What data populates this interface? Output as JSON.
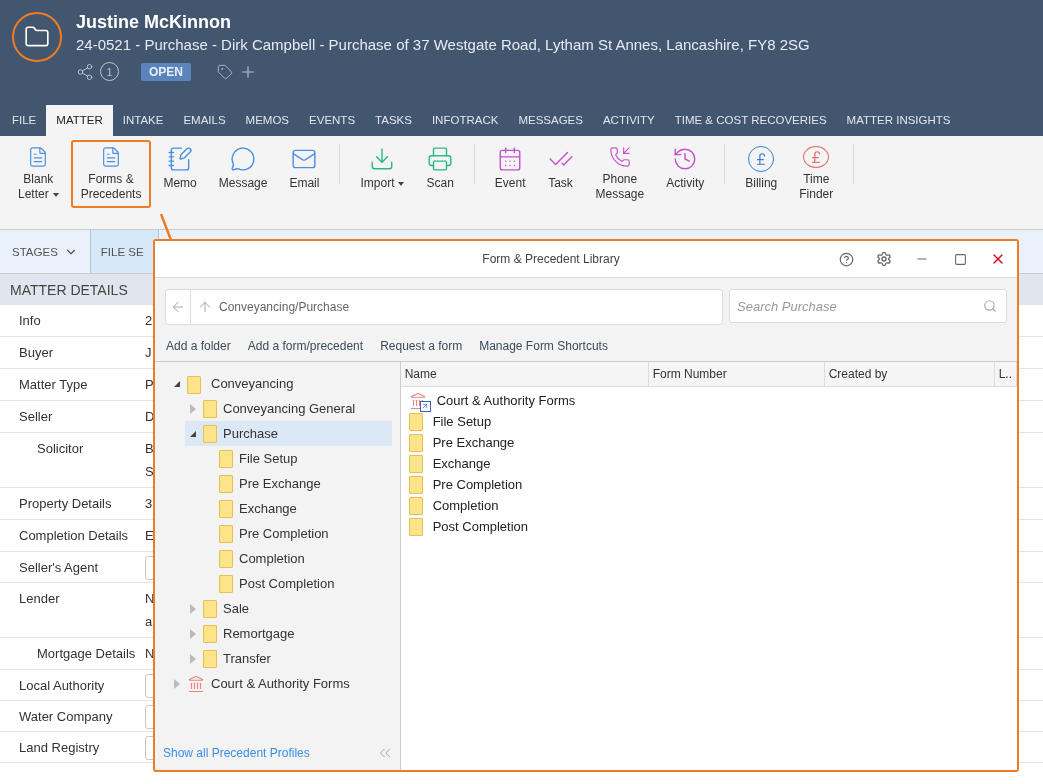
{
  "matter": {
    "client": "Justine McKinnon",
    "description": "24-0521 - Purchase - Dirk Campbell - Purchase of 37 Westgate Road, Lytham St Annes, Lancashire, FY8 2SG",
    "related_count": "1",
    "status": "OPEN"
  },
  "tabs": [
    {
      "label": "FILE",
      "selected": false
    },
    {
      "label": "MATTER",
      "selected": true
    },
    {
      "label": "INTAKE",
      "selected": false
    },
    {
      "label": "EMAILS",
      "selected": false
    },
    {
      "label": "MEMOS",
      "selected": false
    },
    {
      "label": "EVENTS",
      "selected": false
    },
    {
      "label": "TASKS",
      "selected": false
    },
    {
      "label": "INFOTRACK",
      "selected": false
    },
    {
      "label": "MESSAGES",
      "selected": false
    },
    {
      "label": "ACTIVITY",
      "selected": false
    },
    {
      "label": "TIME & COST RECOVERIES",
      "selected": false
    },
    {
      "label": "MATTER INSIGHTS",
      "selected": false
    }
  ],
  "ribbon_groups": [
    [
      {
        "label": "Blank\nLetter",
        "dropdown": true,
        "highlighted": false
      },
      {
        "label": "Forms &\nPrecedents",
        "dropdown": false,
        "highlighted": true
      },
      {
        "label": "Memo",
        "dropdown": false,
        "highlighted": false
      },
      {
        "label": "Message",
        "dropdown": false,
        "highlighted": false
      },
      {
        "label": "Email",
        "dropdown": false,
        "highlighted": false
      }
    ],
    [
      {
        "label": "Import",
        "dropdown": true,
        "highlighted": false
      },
      {
        "label": "Scan",
        "dropdown": false,
        "highlighted": false
      }
    ],
    [
      {
        "label": "Event",
        "dropdown": false,
        "highlighted": false
      },
      {
        "label": "Task",
        "dropdown": false,
        "highlighted": false
      },
      {
        "label": "Phone\nMessage",
        "dropdown": false,
        "highlighted": false
      },
      {
        "label": "Activity",
        "dropdown": false,
        "highlighted": false
      }
    ],
    [
      {
        "label": "Billing",
        "dropdown": false,
        "highlighted": false
      },
      {
        "label": "Time\nFinder",
        "dropdown": false,
        "highlighted": false
      }
    ]
  ],
  "stages": {
    "label": "STAGES",
    "current": "FILE SE"
  },
  "matter_details": {
    "title": "MATTER DETAILS",
    "rows": [
      {
        "label": "Info",
        "kind": "text",
        "lines": [
          "2"
        ]
      },
      {
        "label": "Buyer",
        "kind": "text",
        "lines": [
          "J"
        ]
      },
      {
        "label": "Matter Type",
        "kind": "text",
        "lines": [
          "P"
        ]
      },
      {
        "label": "Seller",
        "kind": "text",
        "lines": [
          "D"
        ]
      },
      {
        "label": "Solicitor",
        "kind": "sub",
        "lines": [
          "B",
          "S"
        ]
      },
      {
        "label": "Property Details",
        "kind": "text",
        "lines": [
          "3"
        ]
      },
      {
        "label": "Completion Details",
        "kind": "text",
        "lines": [
          "E"
        ]
      },
      {
        "label": "Seller's Agent",
        "kind": "lookup",
        "lines": []
      },
      {
        "label": "Lender",
        "kind": "text",
        "lines": [
          "N",
          "a"
        ]
      },
      {
        "label": "Mortgage Details",
        "kind": "sub",
        "lines": [
          "N"
        ]
      },
      {
        "label": "Local Authority",
        "kind": "lookup",
        "lines": []
      },
      {
        "label": "Water Company",
        "kind": "lookup",
        "lines": []
      },
      {
        "label": "Land Registry",
        "kind": "lookup",
        "lines": []
      }
    ]
  },
  "dialog": {
    "title": "Form & Precedent Library",
    "path": "Conveyancing/Purchase",
    "search": {
      "placeholder": "Search Purchase"
    },
    "actions": [
      "Add a folder",
      "Add a form/precedent",
      "Request a form",
      "Manage Form Shortcuts"
    ],
    "tree": [
      {
        "label": "Conveyancing",
        "kind": "library",
        "expanded": true,
        "selected": false,
        "children": [
          {
            "label": "Conveyancing General",
            "kind": "folder",
            "expanded": false,
            "selected": false
          },
          {
            "label": "Purchase",
            "kind": "folder",
            "expanded": true,
            "selected": true,
            "children": [
              {
                "label": "File Setup",
                "kind": "folder",
                "selected": false
              },
              {
                "label": "Pre Exchange",
                "kind": "folder",
                "selected": false
              },
              {
                "label": "Exchange",
                "kind": "folder",
                "selected": false
              },
              {
                "label": "Pre Completion",
                "kind": "folder",
                "selected": false
              },
              {
                "label": "Completion",
                "kind": "folder",
                "selected": false
              },
              {
                "label": "Post Completion",
                "kind": "folder",
                "selected": false
              }
            ]
          },
          {
            "label": "Sale",
            "kind": "folder",
            "expanded": false,
            "selected": false
          },
          {
            "label": "Remortgage",
            "kind": "folder",
            "expanded": false,
            "selected": false
          },
          {
            "label": "Transfer",
            "kind": "folder",
            "expanded": false,
            "selected": false
          }
        ]
      },
      {
        "label": "Court & Authority Forms",
        "kind": "court",
        "expanded": false,
        "selected": false
      }
    ],
    "columns": [
      "Name",
      "Form Number",
      "Created by",
      "L.."
    ],
    "items": [
      {
        "name": "Court & Authority Forms",
        "kind": "court"
      },
      {
        "name": "File Setup",
        "kind": "folder"
      },
      {
        "name": "Pre Exchange",
        "kind": "folder"
      },
      {
        "name": "Exchange",
        "kind": "folder"
      },
      {
        "name": "Pre Completion",
        "kind": "folder"
      },
      {
        "name": "Completion",
        "kind": "folder"
      },
      {
        "name": "Post Completion",
        "kind": "folder"
      }
    ],
    "footer_link": "Show all Precedent Profiles"
  }
}
